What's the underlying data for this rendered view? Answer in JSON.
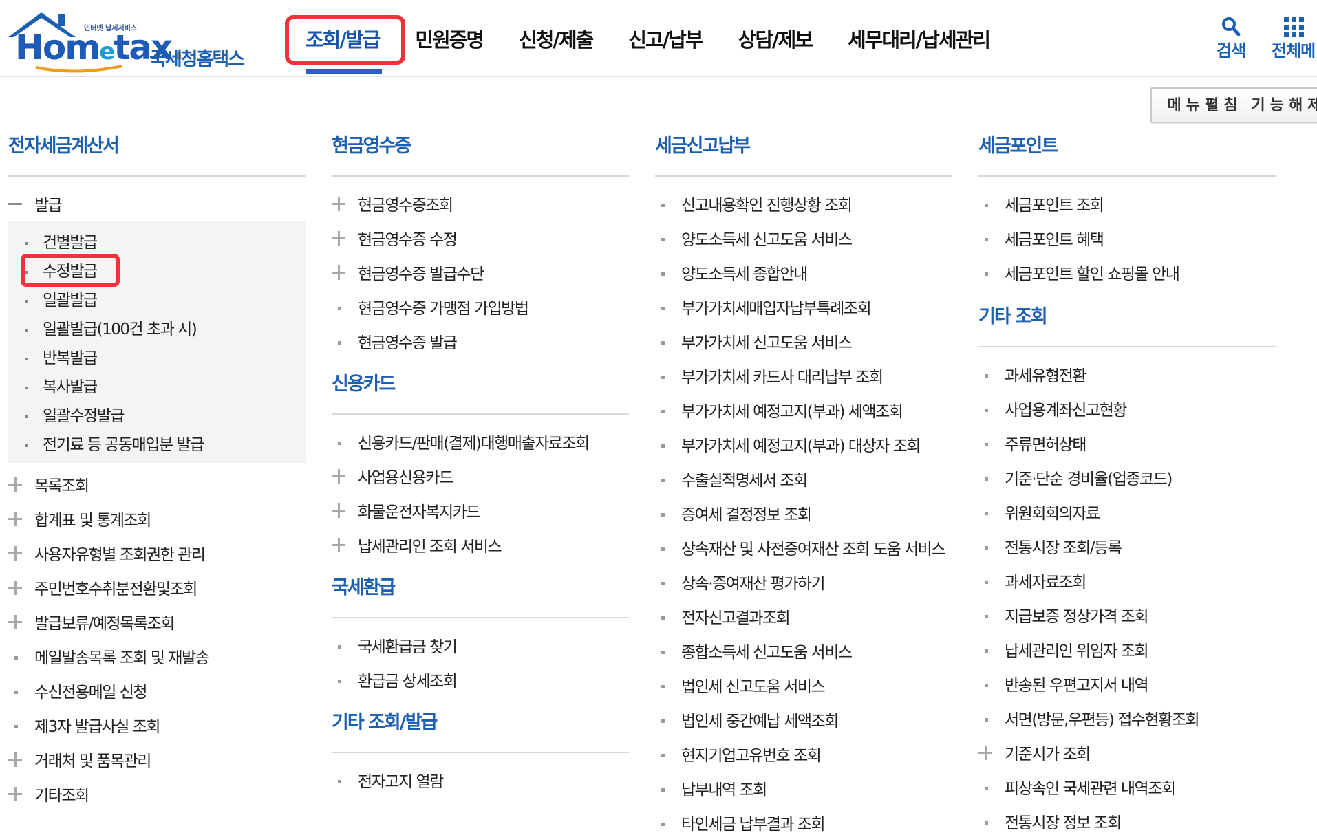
{
  "header": {
    "logo": {
      "tagline": "인터넷 납세서비스",
      "wordmark_a": "Hom",
      "wordmark_e": "e",
      "wordmark_b": "tax",
      "wordmark_dot": ".",
      "korean_name": "국세청홈택스"
    },
    "gnb": [
      {
        "label": "조회/발급",
        "active": true,
        "highlighted": true
      },
      {
        "label": "민원증명"
      },
      {
        "label": "신청/제출"
      },
      {
        "label": "신고/납부"
      },
      {
        "label": "상담/제보"
      },
      {
        "label": "세무대리/납세관리"
      }
    ],
    "search_label": "검색",
    "all_menu_label": "전체메",
    "accent": "#1d5fb0",
    "highlight_color": "#f0323c"
  },
  "menu_unfold_label": "메뉴펼침 기능해제",
  "col1": {
    "title": "전자세금계산서",
    "expanded_label": "발급",
    "sub_items": [
      "건별발급",
      "수정발급",
      "일괄발급",
      "일괄발급(100건 초과 시)",
      "반복발급",
      "복사발급",
      "일괄수정발급",
      "전기료 등 공동매입분 발급"
    ],
    "highlighted_sub": "수정발급",
    "items": [
      "목록조회",
      "합계표 및 통계조회",
      "사용자유형별 조회권한 관리",
      "주민번호수취분전환및조회",
      "발급보류/예정목록조회",
      "메일발송목록 조회 및 재발송",
      "수신전용메일 신청",
      "제3자 발급사실 조회",
      "거래처 및 품목관리",
      "기타조회"
    ]
  },
  "col2": {
    "sections": [
      {
        "title": "현금영수증",
        "items": [
          "현금영수증조회",
          "현금영수증 수정",
          "현금영수증 발급수단",
          "현금영수증 가맹점 가입방법",
          "현금영수증 발급"
        ]
      },
      {
        "title": "신용카드",
        "items": [
          "신용카드/판매(결제)대행매출자료조회",
          "사업용신용카드",
          "화물운전자복지카드",
          "납세관리인 조회 서비스"
        ]
      },
      {
        "title": "국세환급",
        "items": [
          "국세환급금 찾기",
          "환급금 상세조회"
        ]
      },
      {
        "title": "기타 조회/발급",
        "items": [
          "전자고지 열람"
        ]
      }
    ]
  },
  "col3": {
    "title": "세금신고납부",
    "items": [
      "신고내용확인 진행상황 조회",
      "양도소득세 신고도움 서비스",
      "양도소득세 종합안내",
      "부가가치세매입자납부특례조회",
      "부가가치세 신고도움 서비스",
      "부가가치세 카드사 대리납부 조회",
      "부가가치세 예정고지(부과) 세액조회",
      "부가가치세 예정고지(부과) 대상자 조회",
      "수출실적명세서 조회",
      "증여세 결정정보 조회",
      "상속재산 및 사전증여재산 조회 도움 서비스",
      "상속·증여재산 평가하기",
      "전자신고결과조회",
      "종합소득세 신고도움 서비스",
      "법인세 신고도움 서비스",
      "법인세 중간예납 세액조회",
      "현지기업고유번호 조회",
      "납부내역 조회",
      "타인세금 납부결과 조회"
    ]
  },
  "col4": {
    "sections": [
      {
        "title": "세금포인트",
        "items": [
          "세금포인트 조회",
          "세금포인트 혜택",
          "세금포인트 할인 쇼핑몰 안내"
        ]
      },
      {
        "title": "기타 조회",
        "items": [
          "과세유형전환",
          "사업용계좌신고현황",
          "주류면허상태",
          "기준·단순 경비율(업종코드)",
          "위원회회의자료",
          "전통시장 조회/등록",
          "과세자료조회",
          "지급보증 정상가격 조회",
          "납세관리인 위임자 조회",
          "반송된 우편고지서 내역",
          "서면(방문,우편등) 접수현황조회",
          "기준시가 조회",
          "피상속인 국세관련 내역조회",
          "전통시장 정보 조회"
        ]
      }
    ]
  }
}
